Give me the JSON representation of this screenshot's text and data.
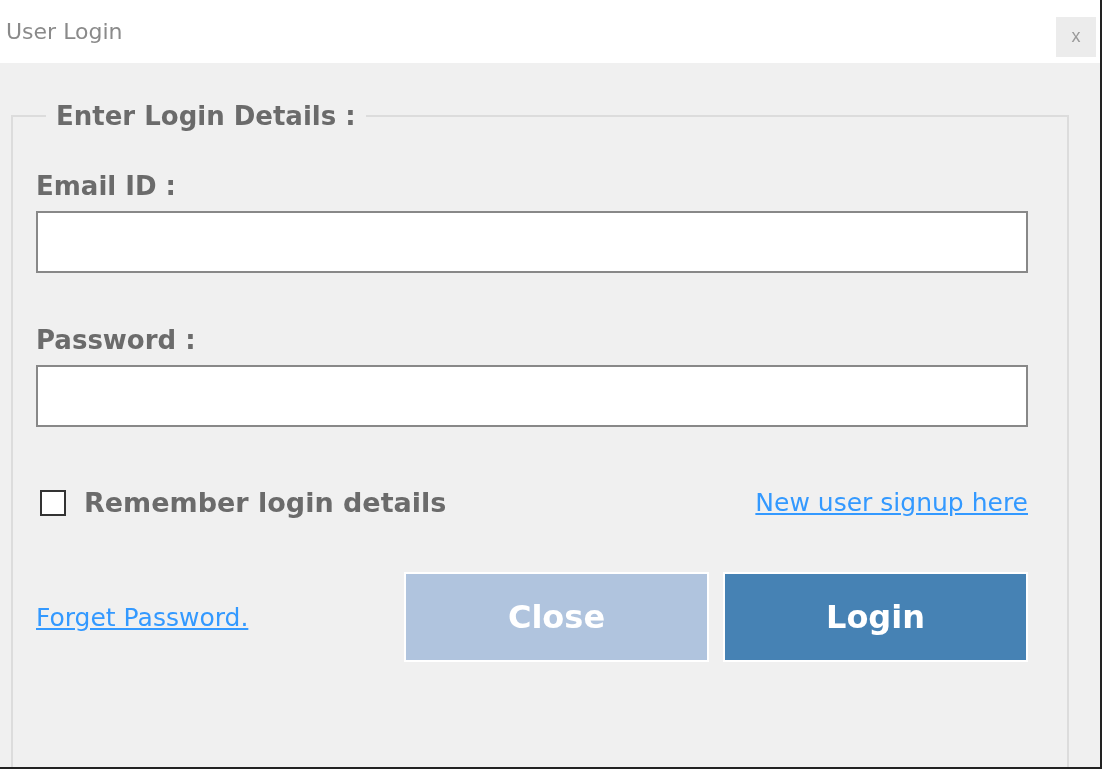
{
  "window": {
    "title": "User Login",
    "close_button": "x"
  },
  "group": {
    "legend": "Enter Login Details :"
  },
  "fields": [
    {
      "label": "Email ID :"
    },
    {
      "label": "Password :"
    }
  ],
  "remember": {
    "label": "Remember login details",
    "checked": false
  },
  "signup_link": "New user signup here",
  "forgot_link": "Forget Password.",
  "buttons": [
    {
      "label": "Close",
      "kind": "secondary"
    },
    {
      "label": "Login",
      "kind": "primary"
    }
  ]
}
